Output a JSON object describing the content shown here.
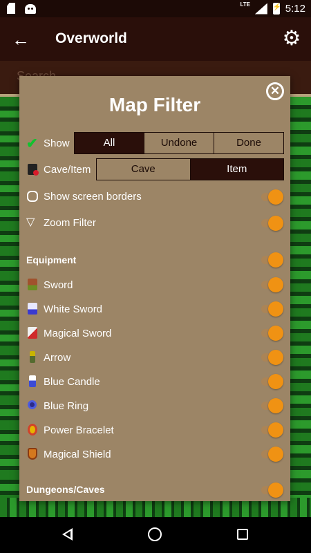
{
  "status_bar": {
    "time": "5:12",
    "network": "LTE",
    "icons": [
      "sd-card-icon",
      "android-notification-icon",
      "signal-icon",
      "battery-charging-icon"
    ]
  },
  "app_bar": {
    "title": "Overworld",
    "back_icon": "arrow-back-icon",
    "settings_icon": "gear-icon"
  },
  "map": {
    "search_placeholder": "Search"
  },
  "dialog": {
    "title": "Map Filter",
    "close_icon": "close-circle-icon",
    "show": {
      "label": "Show",
      "icon": "checkmark-icon",
      "options": [
        "All",
        "Undone",
        "Done"
      ],
      "selected": "All"
    },
    "cave_item": {
      "label": "Cave/Item",
      "icon": "cave-item-icon",
      "options": [
        "Cave",
        "Item"
      ],
      "selected": "Item"
    },
    "settings": [
      {
        "label": "Show screen borders",
        "icon": "screen-border-icon",
        "on": true
      },
      {
        "label": "Zoom Filter",
        "icon": "funnel-icon",
        "on": true
      }
    ],
    "equipment": {
      "title": "Equipment",
      "on": true,
      "items": [
        {
          "label": "Sword",
          "icon": "sword-icon",
          "on": true
        },
        {
          "label": "White Sword",
          "icon": "white-sword-icon",
          "on": true
        },
        {
          "label": "Magical Sword",
          "icon": "magical-sword-icon",
          "on": true
        },
        {
          "label": "Arrow",
          "icon": "arrow-icon",
          "on": true
        },
        {
          "label": "Blue Candle",
          "icon": "blue-candle-icon",
          "on": true
        },
        {
          "label": "Blue Ring",
          "icon": "blue-ring-icon",
          "on": true
        },
        {
          "label": "Power Bracelet",
          "icon": "power-bracelet-icon",
          "on": true
        },
        {
          "label": "Magical Shield",
          "icon": "magical-shield-icon",
          "on": true
        }
      ]
    },
    "dungeons": {
      "title": "Dungeons/Caves",
      "on": true
    }
  },
  "colors": {
    "dialog_bg": "#9c8566",
    "selected_segment": "#2a0f0a",
    "toggle_on": "#f09213",
    "app_bar": "#2a0f0a"
  },
  "nav_bar": {
    "icons": [
      "nav-back-icon",
      "nav-home-icon",
      "nav-recents-icon"
    ]
  }
}
